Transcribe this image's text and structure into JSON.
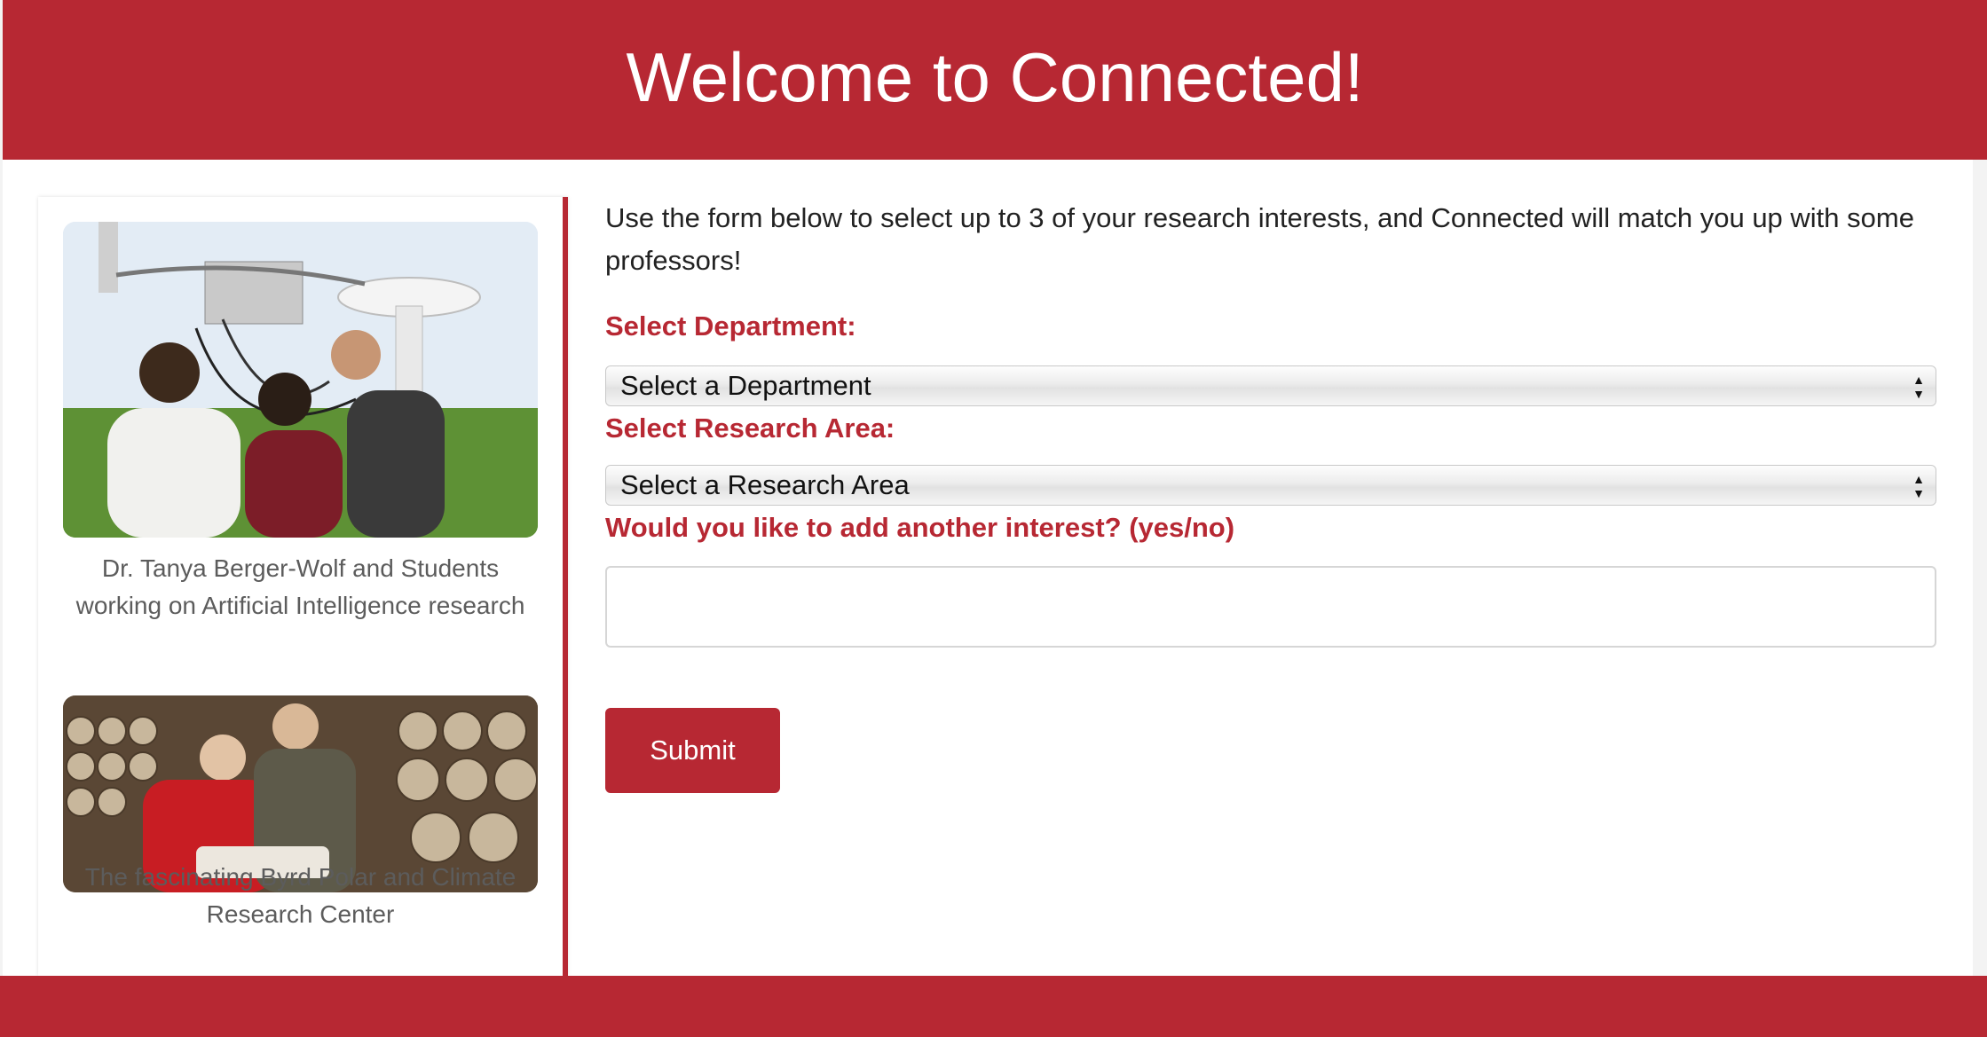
{
  "header": {
    "title": "Welcome to Connected!"
  },
  "sidebar": {
    "photos": [
      {
        "caption": "Dr. Tanya Berger-Wolf and Students working on Artificial Intelligence research"
      },
      {
        "caption": "The fascinating Byrd Polar and Climate Research Center"
      }
    ]
  },
  "form": {
    "intro": "Use the form below to select up to 3 of your research interests, and Connected will match you up with some professors!",
    "department_label": "Select Department:",
    "department_selected": "Select a Department",
    "research_label": "Select Research Area:",
    "research_selected": "Select a Research Area",
    "another_label": "Would you like to add another interest? (yes/no)",
    "another_value": "",
    "submit_label": "Submit"
  },
  "colors": {
    "brand": "#b72833"
  }
}
